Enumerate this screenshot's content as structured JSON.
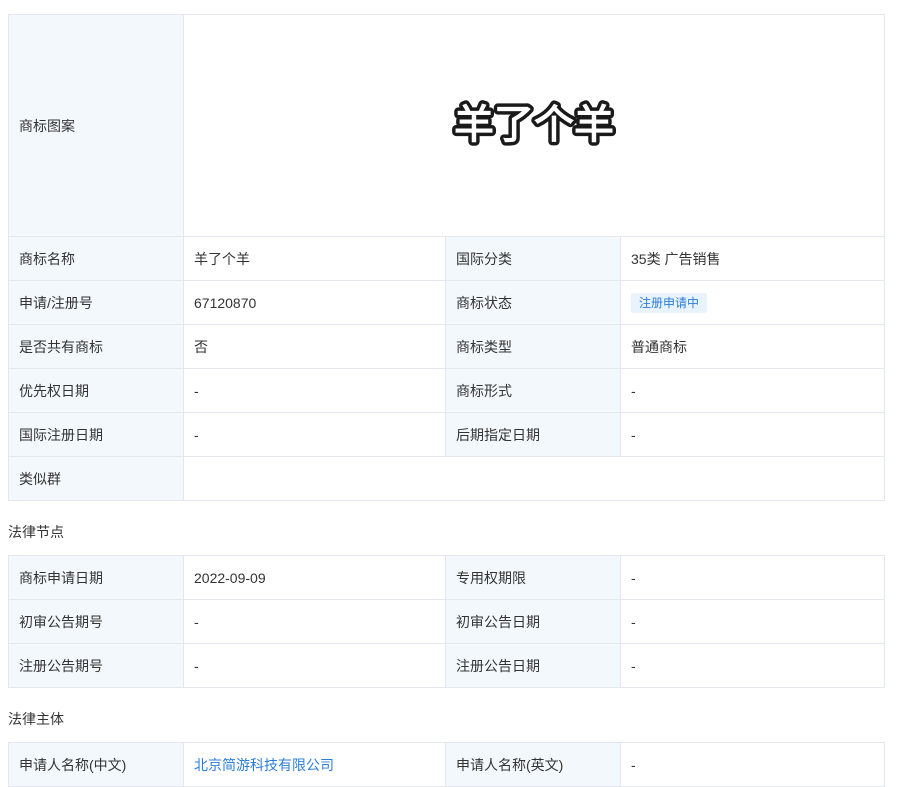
{
  "basic": {
    "logo_label": "商标图案",
    "logo_text": "羊了个羊",
    "rows": [
      {
        "l1": "商标名称",
        "v1": "羊了个羊",
        "l2": "国际分类",
        "v2": "35类 广告销售"
      },
      {
        "l1": "申请/注册号",
        "v1": "67120870",
        "l2": "商标状态",
        "v2": "注册申请中"
      },
      {
        "l1": "是否共有商标",
        "v1": "否",
        "l2": "商标类型",
        "v2": "普通商标"
      },
      {
        "l1": "优先权日期",
        "v1": "-",
        "l2": "商标形式",
        "v2": "-"
      },
      {
        "l1": "国际注册日期",
        "v1": "-",
        "l2": "后期指定日期",
        "v2": "-"
      }
    ],
    "similar_group_label": "类似群",
    "similar_group_value": ""
  },
  "legal_nodes": {
    "title": "法律节点",
    "rows": [
      {
        "l1": "商标申请日期",
        "v1": "2022-09-09",
        "l2": "专用权期限",
        "v2": "-"
      },
      {
        "l1": "初审公告期号",
        "v1": "-",
        "l2": "初审公告日期",
        "v2": "-"
      },
      {
        "l1": "注册公告期号",
        "v1": "-",
        "l2": "注册公告日期",
        "v2": "-"
      }
    ]
  },
  "legal_subject": {
    "title": "法律主体",
    "rows": [
      {
        "l1": "申请人名称(中文)",
        "v1": "北京简游科技有限公司",
        "l2": "申请人名称(英文)",
        "v2": "-"
      }
    ]
  },
  "colors": {
    "label_bg": "#f3f8fd",
    "border": "#e4e8ee",
    "link": "#2b7ed8",
    "badge_bg": "#e8f3fd"
  }
}
